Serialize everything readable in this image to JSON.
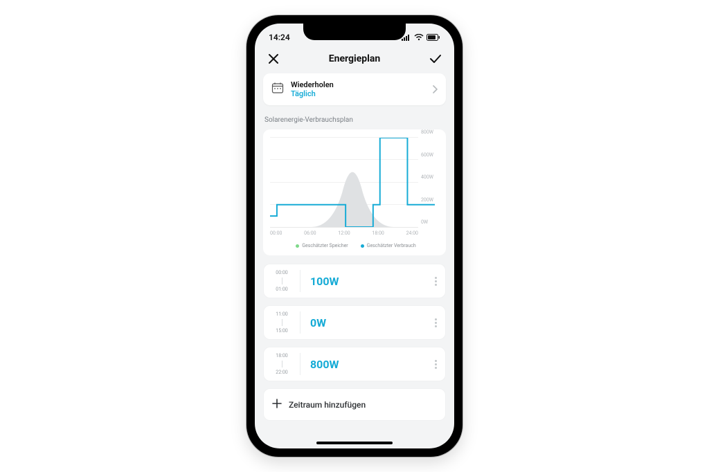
{
  "status": {
    "time": "14:24"
  },
  "header": {
    "title": "Energieplan"
  },
  "repeat": {
    "label": "Wiederholen",
    "value": "Täglich"
  },
  "section": {
    "title": "Solarenergie-Verbrauchsplan"
  },
  "chart_data": {
    "type": "line",
    "title": "Solarenergie-Verbrauchsplan",
    "xlabel": "",
    "ylabel": "",
    "ylim": [
      0,
      800
    ],
    "x_ticks": [
      "00:00",
      "06:00",
      "12:00",
      "18:00",
      "24:00"
    ],
    "y_ticks": [
      "0W",
      "200W",
      "400W",
      "600W",
      "800W"
    ],
    "series": [
      {
        "name": "Geschätzter Verbrauch",
        "color": "#16abd6",
        "step": true,
        "points": [
          {
            "x": 0,
            "y": 100
          },
          {
            "x": 1,
            "y": 200
          },
          {
            "x": 11,
            "y": 200
          },
          {
            "x": 11,
            "y": 0
          },
          {
            "x": 15,
            "y": 0
          },
          {
            "x": 15,
            "y": 200
          },
          {
            "x": 16,
            "y": 200
          },
          {
            "x": 16,
            "y": 800
          },
          {
            "x": 20,
            "y": 800
          },
          {
            "x": 20,
            "y": 200
          },
          {
            "x": 24,
            "y": 200
          }
        ]
      },
      {
        "name": "Geschätzter Speicher",
        "color": "#d6d8da",
        "area": true,
        "points": [
          {
            "x": 6,
            "y": 0
          },
          {
            "x": 9,
            "y": 250
          },
          {
            "x": 12,
            "y": 600
          },
          {
            "x": 15,
            "y": 250
          },
          {
            "x": 18,
            "y": 0
          }
        ]
      }
    ],
    "legend": {
      "storage": "Geschätzter Speicher",
      "consumption": "Geschätzter Verbrauch"
    }
  },
  "slots": [
    {
      "start": "00:00",
      "end": "01:00",
      "power": "100W"
    },
    {
      "start": "11:00",
      "end": "15:00",
      "power": "0W"
    },
    {
      "start": "18:00",
      "end": "22:00",
      "power": "800W"
    }
  ],
  "add": {
    "label": "Zeitraum hinzufügen"
  }
}
